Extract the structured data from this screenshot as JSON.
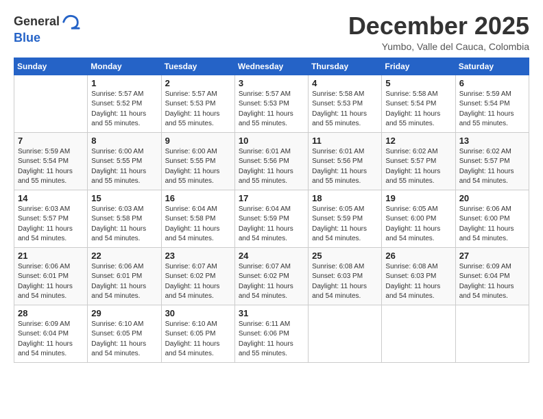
{
  "header": {
    "logo_general": "General",
    "logo_blue": "Blue",
    "month_title": "December 2025",
    "location": "Yumbo, Valle del Cauca, Colombia"
  },
  "days_of_week": [
    "Sunday",
    "Monday",
    "Tuesday",
    "Wednesday",
    "Thursday",
    "Friday",
    "Saturday"
  ],
  "weeks": [
    [
      {
        "day": "",
        "info": ""
      },
      {
        "day": "1",
        "info": "Sunrise: 5:57 AM\nSunset: 5:52 PM\nDaylight: 11 hours\nand 55 minutes."
      },
      {
        "day": "2",
        "info": "Sunrise: 5:57 AM\nSunset: 5:53 PM\nDaylight: 11 hours\nand 55 minutes."
      },
      {
        "day": "3",
        "info": "Sunrise: 5:57 AM\nSunset: 5:53 PM\nDaylight: 11 hours\nand 55 minutes."
      },
      {
        "day": "4",
        "info": "Sunrise: 5:58 AM\nSunset: 5:53 PM\nDaylight: 11 hours\nand 55 minutes."
      },
      {
        "day": "5",
        "info": "Sunrise: 5:58 AM\nSunset: 5:54 PM\nDaylight: 11 hours\nand 55 minutes."
      },
      {
        "day": "6",
        "info": "Sunrise: 5:59 AM\nSunset: 5:54 PM\nDaylight: 11 hours\nand 55 minutes."
      }
    ],
    [
      {
        "day": "7",
        "info": "Sunrise: 5:59 AM\nSunset: 5:54 PM\nDaylight: 11 hours\nand 55 minutes."
      },
      {
        "day": "8",
        "info": "Sunrise: 6:00 AM\nSunset: 5:55 PM\nDaylight: 11 hours\nand 55 minutes."
      },
      {
        "day": "9",
        "info": "Sunrise: 6:00 AM\nSunset: 5:55 PM\nDaylight: 11 hours\nand 55 minutes."
      },
      {
        "day": "10",
        "info": "Sunrise: 6:01 AM\nSunset: 5:56 PM\nDaylight: 11 hours\nand 55 minutes."
      },
      {
        "day": "11",
        "info": "Sunrise: 6:01 AM\nSunset: 5:56 PM\nDaylight: 11 hours\nand 55 minutes."
      },
      {
        "day": "12",
        "info": "Sunrise: 6:02 AM\nSunset: 5:57 PM\nDaylight: 11 hours\nand 55 minutes."
      },
      {
        "day": "13",
        "info": "Sunrise: 6:02 AM\nSunset: 5:57 PM\nDaylight: 11 hours\nand 54 minutes."
      }
    ],
    [
      {
        "day": "14",
        "info": "Sunrise: 6:03 AM\nSunset: 5:57 PM\nDaylight: 11 hours\nand 54 minutes."
      },
      {
        "day": "15",
        "info": "Sunrise: 6:03 AM\nSunset: 5:58 PM\nDaylight: 11 hours\nand 54 minutes."
      },
      {
        "day": "16",
        "info": "Sunrise: 6:04 AM\nSunset: 5:58 PM\nDaylight: 11 hours\nand 54 minutes."
      },
      {
        "day": "17",
        "info": "Sunrise: 6:04 AM\nSunset: 5:59 PM\nDaylight: 11 hours\nand 54 minutes."
      },
      {
        "day": "18",
        "info": "Sunrise: 6:05 AM\nSunset: 5:59 PM\nDaylight: 11 hours\nand 54 minutes."
      },
      {
        "day": "19",
        "info": "Sunrise: 6:05 AM\nSunset: 6:00 PM\nDaylight: 11 hours\nand 54 minutes."
      },
      {
        "day": "20",
        "info": "Sunrise: 6:06 AM\nSunset: 6:00 PM\nDaylight: 11 hours\nand 54 minutes."
      }
    ],
    [
      {
        "day": "21",
        "info": "Sunrise: 6:06 AM\nSunset: 6:01 PM\nDaylight: 11 hours\nand 54 minutes."
      },
      {
        "day": "22",
        "info": "Sunrise: 6:06 AM\nSunset: 6:01 PM\nDaylight: 11 hours\nand 54 minutes."
      },
      {
        "day": "23",
        "info": "Sunrise: 6:07 AM\nSunset: 6:02 PM\nDaylight: 11 hours\nand 54 minutes."
      },
      {
        "day": "24",
        "info": "Sunrise: 6:07 AM\nSunset: 6:02 PM\nDaylight: 11 hours\nand 54 minutes."
      },
      {
        "day": "25",
        "info": "Sunrise: 6:08 AM\nSunset: 6:03 PM\nDaylight: 11 hours\nand 54 minutes."
      },
      {
        "day": "26",
        "info": "Sunrise: 6:08 AM\nSunset: 6:03 PM\nDaylight: 11 hours\nand 54 minutes."
      },
      {
        "day": "27",
        "info": "Sunrise: 6:09 AM\nSunset: 6:04 PM\nDaylight: 11 hours\nand 54 minutes."
      }
    ],
    [
      {
        "day": "28",
        "info": "Sunrise: 6:09 AM\nSunset: 6:04 PM\nDaylight: 11 hours\nand 54 minutes."
      },
      {
        "day": "29",
        "info": "Sunrise: 6:10 AM\nSunset: 6:05 PM\nDaylight: 11 hours\nand 54 minutes."
      },
      {
        "day": "30",
        "info": "Sunrise: 6:10 AM\nSunset: 6:05 PM\nDaylight: 11 hours\nand 54 minutes."
      },
      {
        "day": "31",
        "info": "Sunrise: 6:11 AM\nSunset: 6:06 PM\nDaylight: 11 hours\nand 55 minutes."
      },
      {
        "day": "",
        "info": ""
      },
      {
        "day": "",
        "info": ""
      },
      {
        "day": "",
        "info": ""
      }
    ]
  ]
}
